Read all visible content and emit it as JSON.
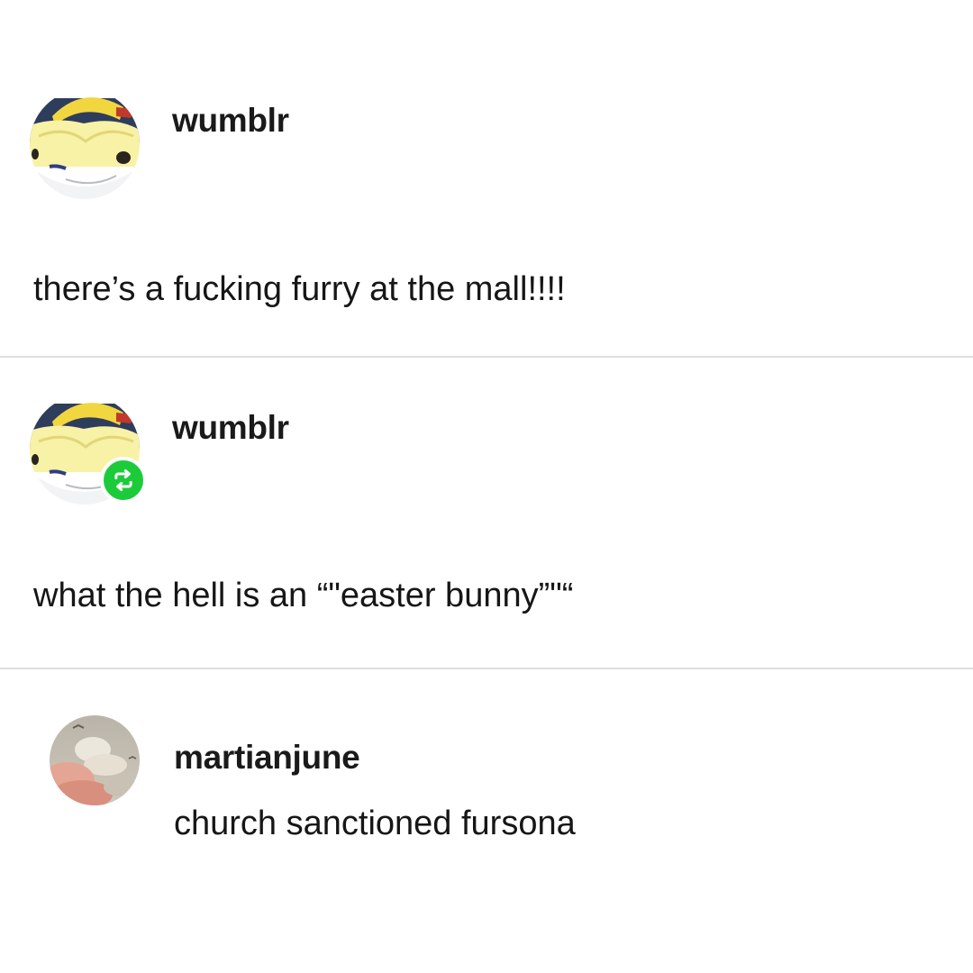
{
  "posts": [
    {
      "username": "wumblr",
      "text": "there’s a fucking furry at the mall!!!!",
      "reblog": false
    },
    {
      "username": "wumblr",
      "text": "what the hell is an “\"easter bunny”\"“",
      "reblog": true
    }
  ],
  "reply": {
    "username": "martianjune",
    "text": "church sanctioned fursona"
  },
  "icons": {
    "reblog": "reblog-icon",
    "avatar_primary": "isabelle-avatar",
    "avatar_reply": "clouds-avatar"
  },
  "colors": {
    "reblog_badge": "#1ccb3a",
    "divider": "#dedede"
  }
}
